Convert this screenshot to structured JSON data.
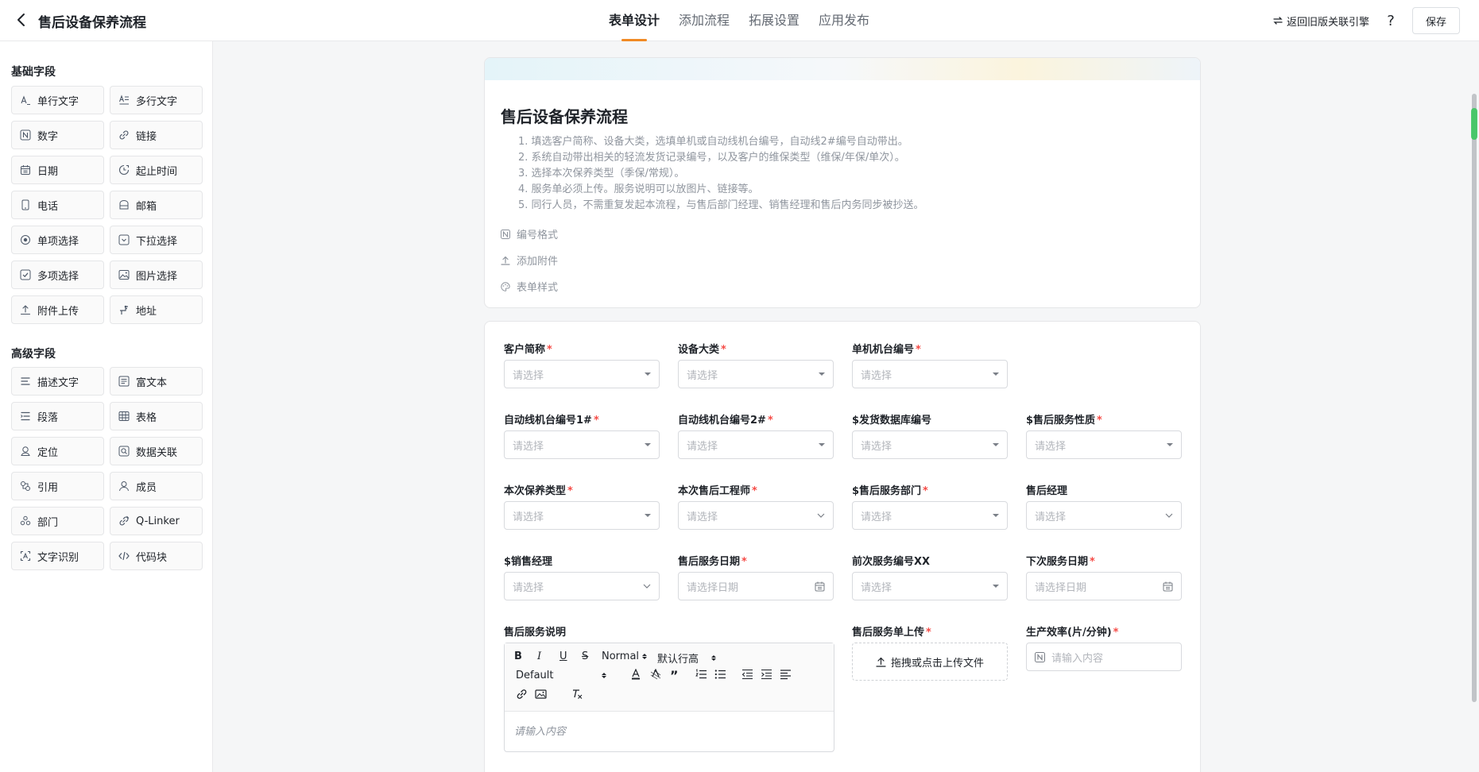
{
  "header": {
    "title": "售后设备保养流程",
    "tabs": [
      "表单设计",
      "添加流程",
      "拓展设置",
      "应用发布"
    ],
    "active_tab": "表单设计",
    "return_link": "返回旧版关联引擎",
    "help": "?",
    "save": "保存"
  },
  "sidebar": {
    "basic_title": "基础字段",
    "basic": [
      {
        "label": "单行文字",
        "icon": "text-line-icon"
      },
      {
        "label": "多行文字",
        "icon": "text-multi-icon"
      },
      {
        "label": "数字",
        "icon": "number-icon"
      },
      {
        "label": "链接",
        "icon": "link-icon"
      },
      {
        "label": "日期",
        "icon": "date-icon"
      },
      {
        "label": "起止时间",
        "icon": "time-range-icon"
      },
      {
        "label": "电话",
        "icon": "phone-icon"
      },
      {
        "label": "邮箱",
        "icon": "mail-icon"
      },
      {
        "label": "单项选择",
        "icon": "radio-icon"
      },
      {
        "label": "下拉选择",
        "icon": "dropdown-icon"
      },
      {
        "label": "多项选择",
        "icon": "checkbox-icon"
      },
      {
        "label": "图片选择",
        "icon": "image-icon"
      },
      {
        "label": "附件上传",
        "icon": "upload-icon"
      },
      {
        "label": "地址",
        "icon": "address-icon"
      }
    ],
    "advanced_title": "高级字段",
    "advanced": [
      {
        "label": "描述文字",
        "icon": "description-icon"
      },
      {
        "label": "富文本",
        "icon": "richtext-icon"
      },
      {
        "label": "段落",
        "icon": "paragraph-icon"
      },
      {
        "label": "表格",
        "icon": "table-icon"
      },
      {
        "label": "定位",
        "icon": "location-icon"
      },
      {
        "label": "数据关联",
        "icon": "data-link-icon"
      },
      {
        "label": "引用",
        "icon": "reference-icon"
      },
      {
        "label": "成员",
        "icon": "member-icon"
      },
      {
        "label": "部门",
        "icon": "department-icon"
      },
      {
        "label": "Q-Linker",
        "icon": "qlinker-icon"
      },
      {
        "label": "文字识别",
        "icon": "ocr-icon"
      },
      {
        "label": "代码块",
        "icon": "code-icon"
      }
    ]
  },
  "form": {
    "title": "售后设备保养流程",
    "description": [
      "1. 填选客户简称、设备大类，选填单机或自动线机台编号，自动线2#编号自动带出。",
      "2. 系统自动带出相关的轻流发货记录编号，以及客户的维保类型（维保/年保/单次）。",
      "3. 选择本次保养类型（季保/常规）。",
      "4. 服务单必须上传。服务说明可以放图片、链接等。",
      "5. 同行人员，不需重复发起本流程，与售后部门经理、销售经理和售后内务同步被抄送。"
    ],
    "meta": {
      "numbering": "编号格式",
      "attachment": "添加附件",
      "style": "表单样式"
    },
    "select_placeholder": "请选择",
    "date_placeholder": "请选择日期",
    "input_placeholder": "请输入内容",
    "fields": [
      {
        "label": "客户简称",
        "required": "*"
      },
      {
        "label": "设备大类",
        "required": "*"
      },
      {
        "label": "单机机台编号",
        "required": "*"
      },
      {
        "label": "自动线机台编号1#",
        "required": "*"
      },
      {
        "label": "自动线机台编号2#",
        "required": "*"
      },
      {
        "label": "$发货数据库编号",
        "required": ""
      },
      {
        "label": "$售后服务性质",
        "required": "*"
      },
      {
        "label": "本次保养类型",
        "required": "*"
      },
      {
        "label": "本次售后工程师",
        "required": "*"
      },
      {
        "label": "$售后服务部门",
        "required": "*"
      },
      {
        "label": "售后经理",
        "required": ""
      },
      {
        "label": "$销售经理",
        "required": ""
      },
      {
        "label": "售后服务日期",
        "required": "*"
      },
      {
        "label": "前次服务编号XX",
        "required": ""
      },
      {
        "label": "下次服务日期",
        "required": "*"
      },
      {
        "label": "售后服务说明",
        "required": ""
      },
      {
        "label": "售后服务单上传",
        "required": "*"
      },
      {
        "label": "生产效率(片/分钟)",
        "required": "*"
      }
    ],
    "upload_text": "拖拽或点击上传文件",
    "rte": {
      "size": "Normal",
      "line_height": "默认行高",
      "font": "Default",
      "placeholder": "请输入内容"
    }
  }
}
